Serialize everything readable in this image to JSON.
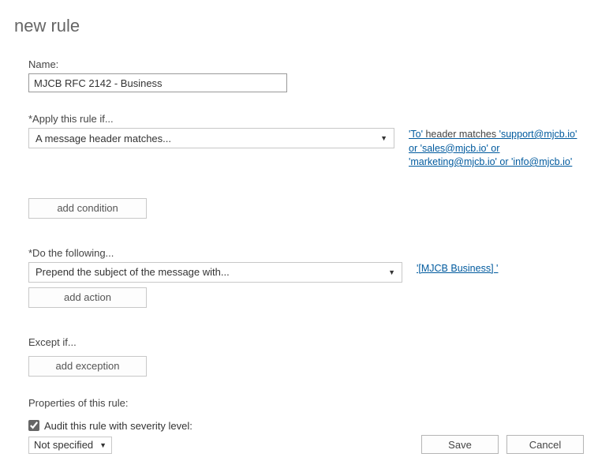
{
  "title": "new rule",
  "name_label": "Name:",
  "name_value": "MJCB RFC 2142 - Business",
  "condition": {
    "label": "*Apply this rule if...",
    "select_value": "A message header matches...",
    "side_prefix": "'To'",
    "side_mid": " header matches ",
    "side_value": "'support@mjcb.io' or 'sales@mjcb.io' or 'marketing@mjcb.io' or 'info@mjcb.io'",
    "add_btn": "add condition"
  },
  "action": {
    "label": "*Do the following...",
    "select_value": "Prepend the subject of the message with...",
    "side_value": "'[MJCB Business] '",
    "add_btn": "add action"
  },
  "except": {
    "label": "Except if...",
    "add_btn": "add exception"
  },
  "properties": {
    "label": "Properties of this rule:",
    "checkbox_label": "Audit this rule with severity level:",
    "checkbox_checked": true,
    "severity_value": "Not specified"
  },
  "footer": {
    "save": "Save",
    "cancel": "Cancel"
  }
}
